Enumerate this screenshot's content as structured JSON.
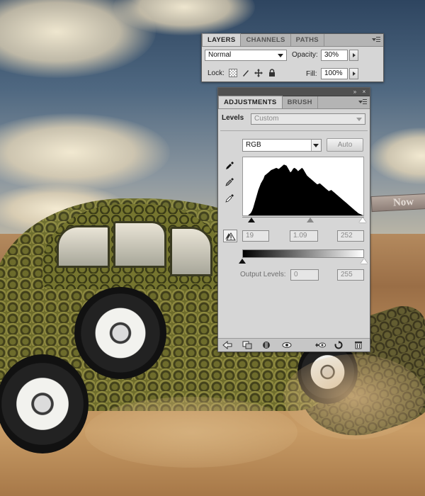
{
  "layers_panel": {
    "tabs": [
      "LAYERS",
      "CHANNELS",
      "PATHS"
    ],
    "active_tab": 0,
    "blend_mode": "Normal",
    "opacity_label": "Opacity:",
    "opacity_value": "30%",
    "lock_label": "Lock:",
    "fill_label": "Fill:",
    "fill_value": "100%",
    "icons": [
      "panel-menu-icon",
      "lock-transparent-icon",
      "lock-brush-icon",
      "lock-move-icon",
      "lock-all-icon"
    ]
  },
  "adjustments_panel": {
    "tabs": [
      "ADJUSTMENTS",
      "BRUSH"
    ],
    "active_tab": 0,
    "header_buttons": [
      "collapse-icon",
      "close-icon"
    ],
    "title": "Levels",
    "preset": "Custom",
    "channel": "RGB",
    "auto_label": "Auto",
    "input_black": "19",
    "input_gamma": "1.09",
    "input_white": "252",
    "output_label": "Output Levels:",
    "output_black": "0",
    "output_white": "255",
    "histogram_sliders": {
      "black": 19,
      "gamma": 1.09,
      "white": 252,
      "range": [
        0,
        255
      ]
    },
    "output_sliders": {
      "black": 0,
      "white": 255
    },
    "histogram_profile": [
      0,
      0,
      0,
      0,
      0,
      2,
      4,
      8,
      14,
      22,
      30,
      38,
      46,
      52,
      58,
      62,
      66,
      72,
      74,
      76,
      78,
      80,
      82,
      83,
      84,
      85,
      86,
      85,
      84,
      86,
      88,
      90,
      92,
      91,
      90,
      86,
      82,
      78,
      80,
      84,
      86,
      85,
      83,
      80,
      82,
      84,
      86,
      84,
      80,
      76,
      72,
      70,
      68,
      66,
      64,
      62,
      60,
      58,
      56,
      57,
      58,
      56,
      54,
      52,
      50,
      48,
      46,
      44,
      45,
      46,
      44,
      42,
      40,
      38,
      36,
      34,
      32,
      30,
      28,
      26,
      24,
      22,
      20,
      18,
      16,
      14,
      12,
      10,
      8,
      6,
      4,
      3,
      2,
      1,
      0
    ],
    "tool_icons": [
      "black-eyedropper-icon",
      "gray-eyedropper-icon",
      "white-eyedropper-icon",
      "clipping-warning-icon"
    ],
    "footer_icons": [
      "back-arrow-icon",
      "clip-to-layer-icon",
      "visibility-toggle-icon",
      "eye-icon",
      "view-previous-icon",
      "reset-icon",
      "trash-icon"
    ]
  },
  "scene": {
    "sign_text": "Now"
  }
}
